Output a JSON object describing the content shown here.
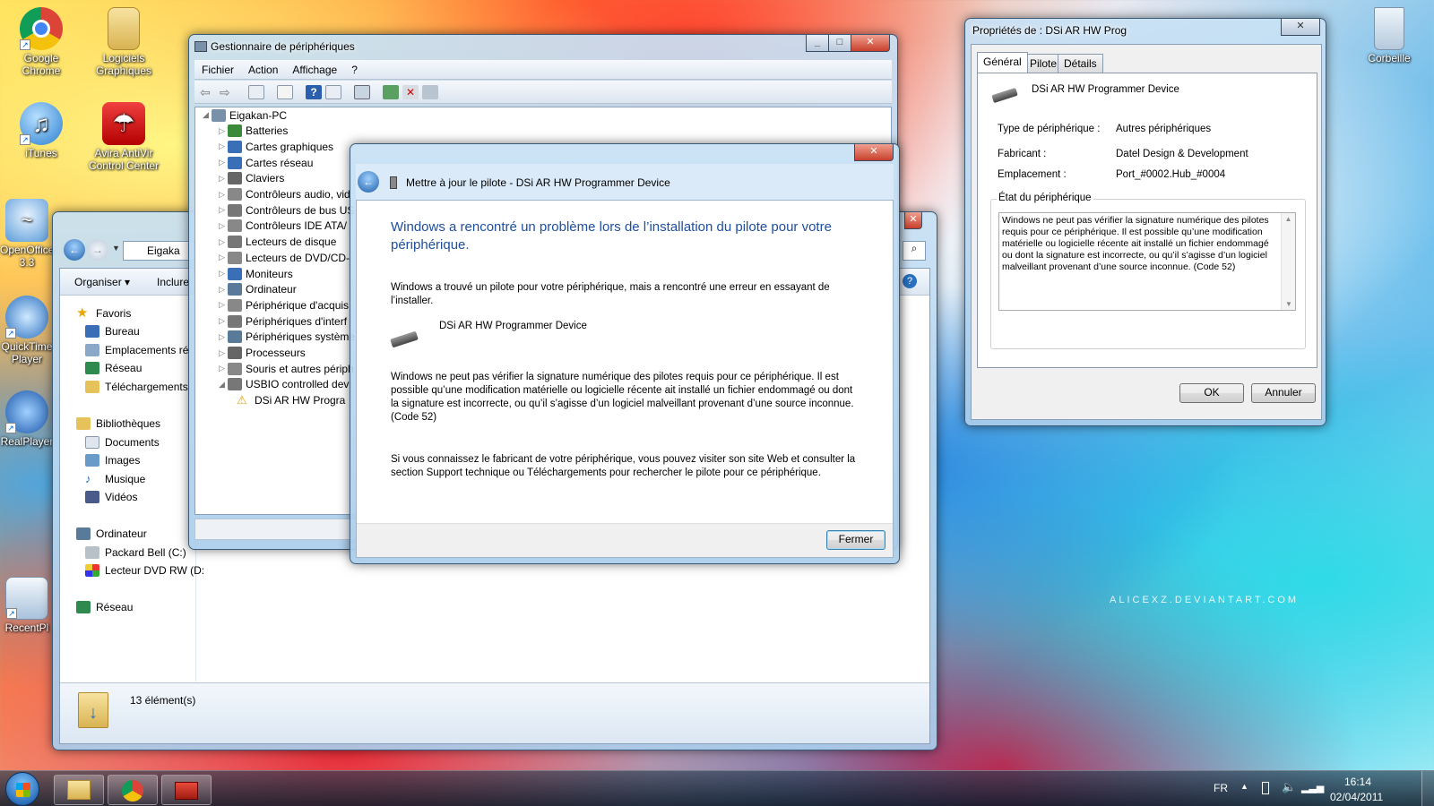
{
  "desktop": {
    "icons": [
      {
        "label": "Google Chrome"
      },
      {
        "label": "Logiciels Graphiques"
      },
      {
        "label": "iTunes"
      },
      {
        "label": "Avira AntiVir Control Center"
      },
      {
        "label": "OpenOffice 3.3"
      },
      {
        "label": "QuickTime Player"
      },
      {
        "label": "RealPlayer"
      },
      {
        "label": "RecentPl"
      },
      {
        "label": "Corbeille"
      }
    ],
    "watermark": "ALICEXZ.DEVIANTART.COM"
  },
  "device_manager": {
    "title": "Gestionnaire de périphériques",
    "menu": [
      "Fichier",
      "Action",
      "Affichage",
      "?"
    ],
    "tree": {
      "root": "Eigakan-PC",
      "items": [
        "Batteries",
        "Cartes graphiques",
        "Cartes réseau",
        "Claviers",
        "Contrôleurs audio, vid",
        "Contrôleurs de bus US",
        "Contrôleurs IDE ATA/",
        "Lecteurs de disque",
        "Lecteurs de DVD/CD-",
        "Moniteurs",
        "Ordinateur",
        "Périphérique d'acquis",
        "Périphériques d'interf",
        "Périphériques système",
        "Processeurs",
        "Souris et autres périph",
        "USBIO controlled devi"
      ],
      "child": "DSi AR HW Progra"
    }
  },
  "explorer": {
    "address": "Eigaka",
    "toolbar": {
      "organize": "Organiser",
      "include": "Inclure"
    },
    "nav": {
      "favorites": "Favoris",
      "favorites_items": [
        "Bureau",
        "Emplacements ré",
        "Réseau",
        "Téléchargements"
      ],
      "libraries": "Bibliothèques",
      "libraries_items": [
        "Documents",
        "Images",
        "Musique",
        "Vidéos"
      ],
      "computer": "Ordinateur",
      "computer_items": [
        "Packard Bell (C:)",
        "Lecteur DVD RW (D:"
      ],
      "network": "Réseau"
    },
    "status": "13 élément(s)"
  },
  "update_dialog": {
    "header": "Mettre à jour le pilote - DSi AR HW Programmer Device",
    "heading": "Windows a rencontré un problème lors de l’installation du pilote pour votre périphérique.",
    "para1": "Windows a trouvé un pilote pour votre périphérique, mais a rencontré une erreur en essayant de l’installer.",
    "device_name": "DSi AR HW Programmer Device",
    "para2": "Windows ne peut pas vérifier la signature numérique des pilotes requis pour ce périphérique. Il est possible qu’une modification matérielle ou logicielle récente ait installé un fichier endommagé ou dont la signature est incorrecte, ou qu’il s’agisse d’un logiciel malveillant provenant d’une source inconnue. (Code 52)",
    "para3": "Si vous connaissez le fabricant de votre périphérique, vous pouvez visiter son site Web et consulter la section Support technique ou Téléchargements pour rechercher le pilote pour ce périphérique.",
    "close_button": "Fermer"
  },
  "properties": {
    "title": "Propriétés de : DSi AR HW Prog",
    "tabs": [
      "Général",
      "Pilote",
      "Détails"
    ],
    "device_name": "DSi AR HW Programmer Device",
    "fields": [
      {
        "label": "Type de périphérique :",
        "value": "Autres périphériques"
      },
      {
        "label": "Fabricant :",
        "value": "Datel Design & Development"
      },
      {
        "label": "Emplacement :",
        "value": "Port_#0002.Hub_#0004"
      }
    ],
    "status_group": "État du périphérique",
    "status_text": "Windows ne peut pas vérifier la signature numérique des pilotes requis pour ce périphérique. Il est possible qu’une modification matérielle ou logicielle récente ait installé un fichier endommagé ou dont la signature est incorrecte, ou qu’il s’agisse d’un logiciel malveillant provenant d’une source inconnue. (Code 52)",
    "ok": "OK",
    "cancel": "Annuler"
  },
  "taskbar": {
    "language": "FR",
    "time": "16:14",
    "date": "02/04/2011"
  }
}
